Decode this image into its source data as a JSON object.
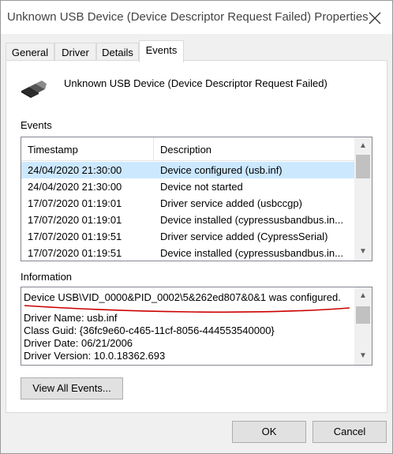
{
  "window": {
    "title": "Unknown USB Device (Device Descriptor Request Failed) Properties"
  },
  "tabs": [
    {
      "label": "General",
      "active": false
    },
    {
      "label": "Driver",
      "active": false
    },
    {
      "label": "Details",
      "active": false
    },
    {
      "label": "Events",
      "active": true
    }
  ],
  "device": {
    "name": "Unknown USB Device (Device Descriptor Request Failed)",
    "icon": "usb-plug-icon"
  },
  "events": {
    "section_label": "Events",
    "columns": {
      "timestamp": "Timestamp",
      "description": "Description"
    },
    "rows": [
      {
        "timestamp": "24/04/2020 21:30:00",
        "description": "Device configured (usb.inf)",
        "selected": true
      },
      {
        "timestamp": "24/04/2020 21:30:00",
        "description": "Device not started",
        "selected": false
      },
      {
        "timestamp": "17/07/2020 01:19:01",
        "description": "Driver service added (usbccgp)",
        "selected": false
      },
      {
        "timestamp": "17/07/2020 01:19:01",
        "description": "Device installed (cypressusbandbus.in...",
        "selected": false
      },
      {
        "timestamp": "17/07/2020 01:19:51",
        "description": "Driver service added (CypressSerial)",
        "selected": false
      },
      {
        "timestamp": "17/07/2020 01:19:51",
        "description": "Device installed (cypressusbandbus.in...",
        "selected": false
      }
    ]
  },
  "information": {
    "section_label": "Information",
    "lines": [
      "Device USB\\VID_0000&PID_0002\\5&262ed807&0&1 was configured.",
      "",
      "Driver Name: usb.inf",
      "Class Guid: {36fc9e60-c465-11cf-8056-444553540000}",
      "Driver Date: 06/21/2006",
      "Driver Version: 10.0.18362.693"
    ]
  },
  "buttons": {
    "view_all": "View All Events...",
    "ok": "OK",
    "cancel": "Cancel"
  },
  "colors": {
    "selection": "#cce8ff",
    "annotation_underline": "#cc0000"
  }
}
